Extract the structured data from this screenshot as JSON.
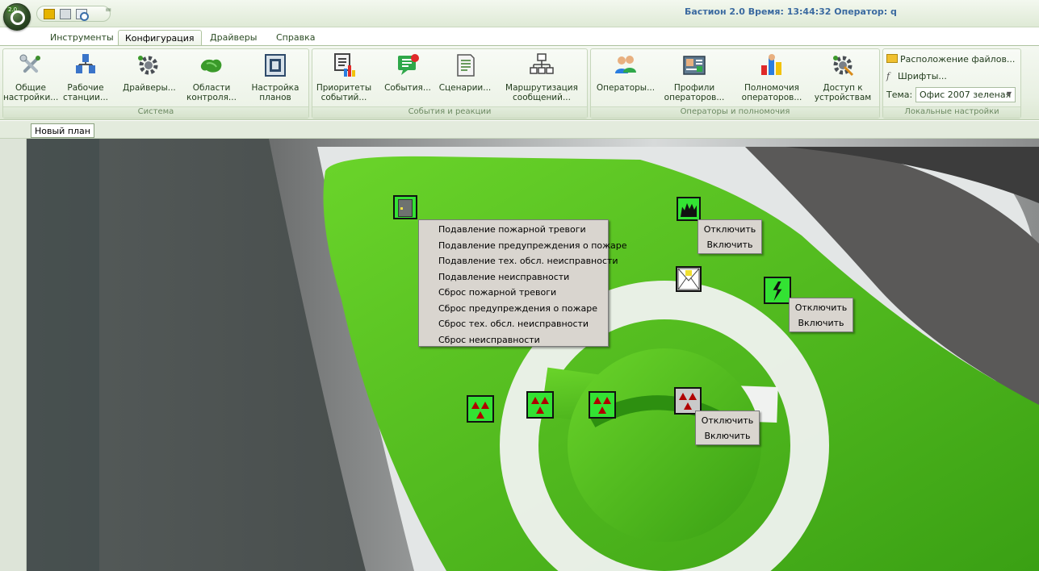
{
  "title_bar": {
    "app_version_badge": "2.0",
    "window_title": "Бастион 2.0 Время: 13:44:32 Оператор: q",
    "qat_more_glyph": "="
  },
  "tabs": [
    {
      "label": "Инструменты"
    },
    {
      "label": "Конфигурация"
    },
    {
      "label": "Драйверы"
    },
    {
      "label": "Справка"
    }
  ],
  "ribbon": {
    "system": {
      "label": "Система",
      "buttons": [
        {
          "label": "Общие\nнастройки...",
          "icon": "tools-icon"
        },
        {
          "label": "Рабочие\nстанции...",
          "icon": "workstations-icon"
        },
        {
          "label": "Драйверы...",
          "icon": "drivers-gear-icon"
        },
        {
          "label": "Области\nконтроля...",
          "icon": "control-areas-icon"
        },
        {
          "label": "Настройка\nпланов",
          "icon": "plans-icon"
        }
      ]
    },
    "events": {
      "label": "События и реакции",
      "buttons": [
        {
          "label": "Приоритеты\nсобытий...",
          "icon": "event-priorities-icon"
        },
        {
          "label": "События...",
          "icon": "events-icon"
        },
        {
          "label": "Сценарии...",
          "icon": "scenarios-icon"
        },
        {
          "label": "Маршрутизация\nсообщений...",
          "icon": "message-routing-icon"
        }
      ]
    },
    "operators": {
      "label": "Операторы и полномочия",
      "buttons": [
        {
          "label": "Операторы...",
          "icon": "operators-icon"
        },
        {
          "label": "Профили\nоператоров...",
          "icon": "operator-profiles-icon"
        },
        {
          "label": "Полномочия\nоператоров...",
          "icon": "operator-permissions-icon"
        },
        {
          "label": "Доступ к\nустройствам",
          "icon": "device-access-icon"
        }
      ]
    },
    "local": {
      "label": "Локальные настройки",
      "files_label": "Расположение файлов...",
      "fonts_label": "Шрифты...",
      "theme_label": "Тема:",
      "theme_value": "Офис 2007 зеленая"
    }
  },
  "doc_tab": {
    "label": "Новый план"
  },
  "context_menu_main": [
    "Подавление пожарной тревоги",
    "Подавление предупреждения о пожаре",
    "Подавление тех. обсл. неисправности",
    "Подавление неисправности",
    "Сброс пожарной тревоги",
    "Сброс предупреждения о пожаре",
    "Сброс тех. обсл. неисправности",
    "Сброс неисправности"
  ],
  "context_menu_small": {
    "disable": "Отключить",
    "enable": "Включить"
  },
  "colors": {
    "device_green": "#33e233",
    "device_gray": "#c9c9c9",
    "alarm_red": "#b00000",
    "title_blue": "#3b6aa0"
  }
}
